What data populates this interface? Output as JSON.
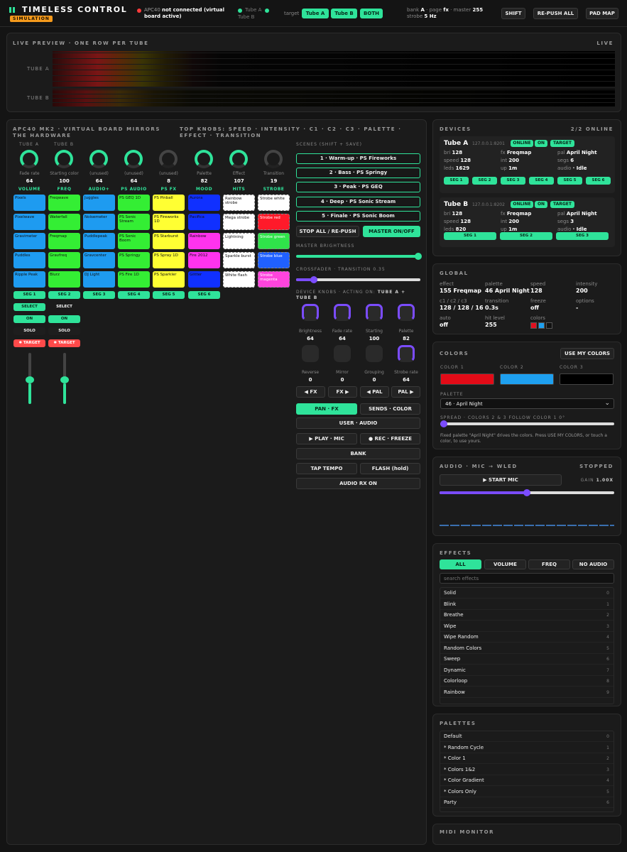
{
  "app": {
    "title": "TIMELESS CONTROL",
    "badge": "SIMULATION"
  },
  "conn": {
    "device": "APC40",
    "status": "not connected (virtual board active)",
    "tubes": [
      "Tube A",
      "Tube B"
    ]
  },
  "target": {
    "label": "target",
    "buttons": [
      "Tube A",
      "Tube B",
      "BOTH"
    ]
  },
  "bank": {
    "k1": "bank",
    "v1": "A",
    "k2": "page",
    "v2": "fx",
    "k3": "master",
    "v3": "255",
    "k4": "strobe",
    "v4": "5 Hz"
  },
  "header_buttons": [
    "SHIFT",
    "RE-PUSH ALL",
    "PAD MAP"
  ],
  "preview": {
    "title": "LIVE PREVIEW · ONE ROW PER TUBE",
    "live": "LIVE",
    "rows": [
      "TUBE A",
      "TUBE B"
    ]
  },
  "board": {
    "title1": "APC40 MK2 · VIRTUAL BOARD MIRRORS THE HARDWARE",
    "title2": "TOP KNOBS: SPEED · INTENSITY · C1 · C2 · C3 · PALETTE · EFFECT · TRANSITION",
    "columns": [
      {
        "top": "TUBE A",
        "name": "Fade rate",
        "value": "64",
        "label": "VOLUME"
      },
      {
        "top": "TUBE B",
        "name": "Starting color",
        "value": "100",
        "label": "FREQ"
      },
      {
        "top": "",
        "name": "(unused)",
        "value": "64",
        "label": "AUDIO+"
      },
      {
        "top": "",
        "name": "(unused)",
        "value": "64",
        "label": "PS AUDIO"
      },
      {
        "top": "",
        "name": "(unused)",
        "value": "8",
        "label": "PS FX"
      },
      {
        "top": "",
        "name": "Palette",
        "value": "82",
        "label": "MOOD"
      },
      {
        "top": "",
        "name": "Effect",
        "value": "107",
        "label": "HITS"
      },
      {
        "top": "",
        "name": "Transition",
        "value": "19",
        "label": "STROBE"
      }
    ],
    "pads": [
      [
        "Pixels",
        "Freqwave",
        "Juggles",
        "PS GEQ 1D",
        "PS Pinball",
        "Aurora",
        "Rainbow strobe",
        "Strobe white"
      ],
      [
        "Pixelwave",
        "Waterfall",
        "Noisemeter",
        "PS Sonic Stream",
        "PS Fireworks 1D",
        "Pacifica",
        "Mega strobe",
        "Strobe red"
      ],
      [
        "Gravimeter",
        "Freqmap",
        "Puddlepeak",
        "PS Sonic Boom",
        "PS Starburst",
        "Rainbow",
        "Lightning",
        "Strobe green"
      ],
      [
        "Puddles",
        "Gravfreq",
        "Gravcenter",
        "PS Springy",
        "PS Spray 1D",
        "Fire 2012",
        "Sparkle burst",
        "Strobe blue"
      ],
      [
        "Ripple Peak",
        "Blurz",
        "DJ Light",
        "PS Fire 1D",
        "PS Sparkler",
        "Glitter",
        "White flash",
        "Strobe magenta"
      ]
    ],
    "pad_colors": [
      "#1e9bf0",
      "#34ee34",
      "#1e9bf0",
      "#34ee34",
      "#ffff33",
      "#1030ff",
      "#ffffff",
      "#ffffff"
    ],
    "segs": [
      "SEG 1",
      "SEG 2",
      "SEG 3",
      "SEG 4",
      "SEG 5",
      "SEG 6"
    ],
    "select": "SELECT",
    "on": "ON",
    "solo": "SOLO",
    "target": "✱ TARGET"
  },
  "scenes": {
    "title": "SCENES (SHIFT + SAVE)",
    "items": [
      "1 · Warm-up · PS Fireworks",
      "2 · Bass · PS Springy",
      "3 · Peak · PS GEQ",
      "4 · Deep · PS Sonic Stream",
      "5 · Finale · PS Sonic Boom"
    ],
    "stop": "STOP ALL / RE-PUSH",
    "master_onoff": "MASTER ON/OFF",
    "master_brightness": "MASTER BRIGHTNESS",
    "master_level": 0.98,
    "crossfader": "CROSSFADER · TRANSITION 0.35",
    "crossfader_value": 0.05
  },
  "device_knobs": {
    "title_pre": "DEVICE KNOBS · ACTING ON:",
    "title_target": "TUBE A + TUBE B",
    "knobs": [
      {
        "name": "Brightness",
        "value": "64"
      },
      {
        "name": "Fade rate",
        "value": "64"
      },
      {
        "name": "Starting",
        "value": "100"
      },
      {
        "name": "Palette",
        "value": "82"
      },
      {
        "name": "Reverse",
        "value": "0"
      },
      {
        "name": "Mirror",
        "value": "0"
      },
      {
        "name": "Grouping",
        "value": "0"
      },
      {
        "name": "Strobe rate",
        "value": "64"
      }
    ],
    "nav": [
      "◀ FX",
      "FX ▶",
      "◀ PAL",
      "PAL ▶"
    ],
    "mode": [
      "PAN · FX",
      "SENDS · COLOR"
    ],
    "user_audio": "USER · AUDIO",
    "play": "▶ PLAY · MIC",
    "rec": "● REC · FREEZE",
    "bank": "BANK",
    "tap": "TAP TEMPO",
    "flash": "FLASH (hold)",
    "audio_rx": "AUDIO RX ON"
  },
  "devices": {
    "title": "DEVICES",
    "count": "2/2 ONLINE",
    "list": [
      {
        "name": "Tube A",
        "ip": "127.0.0.1:8201",
        "badges": [
          "ONLINE",
          "ON",
          "TARGET"
        ],
        "stats": [
          [
            "bri",
            "128"
          ],
          [
            "fx",
            "Freqmap"
          ],
          [
            "pal",
            "April Night"
          ],
          [
            "speed",
            "128"
          ],
          [
            "int",
            "200"
          ],
          [
            "segs",
            "6"
          ],
          [
            "leds",
            "1629"
          ],
          [
            "up",
            "1m"
          ],
          [
            "audio",
            "· Idle"
          ]
        ],
        "segs": [
          "SEG 1",
          "SEG 2",
          "SEG 3",
          "SEG 4",
          "SEG 5",
          "SEG 6"
        ]
      },
      {
        "name": "Tube B",
        "ip": "127.0.0.1:8202",
        "badges": [
          "ONLINE",
          "ON",
          "TARGET"
        ],
        "stats": [
          [
            "bri",
            "128"
          ],
          [
            "fx",
            "Freqmap"
          ],
          [
            "pal",
            "April Night"
          ],
          [
            "speed",
            "128"
          ],
          [
            "int",
            "200"
          ],
          [
            "segs",
            "3"
          ],
          [
            "leds",
            "820"
          ],
          [
            "up",
            "1m"
          ],
          [
            "audio",
            "· Idle"
          ]
        ],
        "segs": [
          "SEG 1",
          "SEG 2",
          "SEG 3"
        ]
      }
    ]
  },
  "global": {
    "title": "GLOBAL",
    "fields": [
      {
        "k": "effect",
        "v": "155 Freqmap"
      },
      {
        "k": "palette",
        "v": "46 April Night"
      },
      {
        "k": "speed",
        "v": "128"
      },
      {
        "k": "intensity",
        "v": "200"
      },
      {
        "k": "c1 / c2 / c3",
        "v": "128 / 128 / 16"
      },
      {
        "k": "transition",
        "v": "0.3s"
      },
      {
        "k": "freeze",
        "v": "off"
      },
      {
        "k": "options",
        "v": "-"
      },
      {
        "k": "auto",
        "v": "off"
      },
      {
        "k": "hit level",
        "v": "255"
      },
      {
        "k": "colors",
        "v": ""
      }
    ],
    "swatches": [
      "#e01020",
      "#1ea0f0",
      "#111111"
    ]
  },
  "colors": {
    "title": "COLORS",
    "use_mine": "USE MY COLORS",
    "labels": [
      "COLOR 1",
      "COLOR 2",
      "COLOR 3"
    ],
    "values": [
      "#e30b17",
      "#1ea0f0",
      "#000000"
    ],
    "palette_label": "PALETTE",
    "palette_value": "46 · April Night",
    "spread": "SPREAD · COLORS 2 & 3 FOLLOW COLOR 1 0°",
    "spread_value": 0.0,
    "note": "Fixed palette \"April Night\" drives the colors. Press USE MY COLORS, or touch a color, to use yours."
  },
  "audio": {
    "title": "AUDIO · MIC → WLED",
    "status": "STOPPED",
    "start": "▶ START MIC",
    "gain": "GAIN",
    "gain_value": "1.00X",
    "gain_level": 0.5
  },
  "effects": {
    "title": "EFFECTS",
    "tabs": [
      "ALL",
      "VOLUME",
      "FREQ",
      "NO AUDIO"
    ],
    "search": "search effects",
    "list": [
      [
        "Solid",
        "0"
      ],
      [
        "Blink",
        "1"
      ],
      [
        "Breathe",
        "2"
      ],
      [
        "Wipe",
        "3"
      ],
      [
        "Wipe Random",
        "4"
      ],
      [
        "Random Colors",
        "5"
      ],
      [
        "Sweep",
        "6"
      ],
      [
        "Dynamic",
        "7"
      ],
      [
        "Colorloop",
        "8"
      ],
      [
        "Rainbow",
        "9"
      ]
    ]
  },
  "palettes": {
    "title": "PALETTES",
    "list": [
      [
        "Default",
        "0"
      ],
      [
        "* Random Cycle",
        "1"
      ],
      [
        "* Color 1",
        "2"
      ],
      [
        "* Colors 1&2",
        "3"
      ],
      [
        "* Color Gradient",
        "4"
      ],
      [
        "* Colors Only",
        "5"
      ],
      [
        "Party",
        "6"
      ]
    ]
  },
  "midi": {
    "title": "MIDI MONITOR"
  }
}
